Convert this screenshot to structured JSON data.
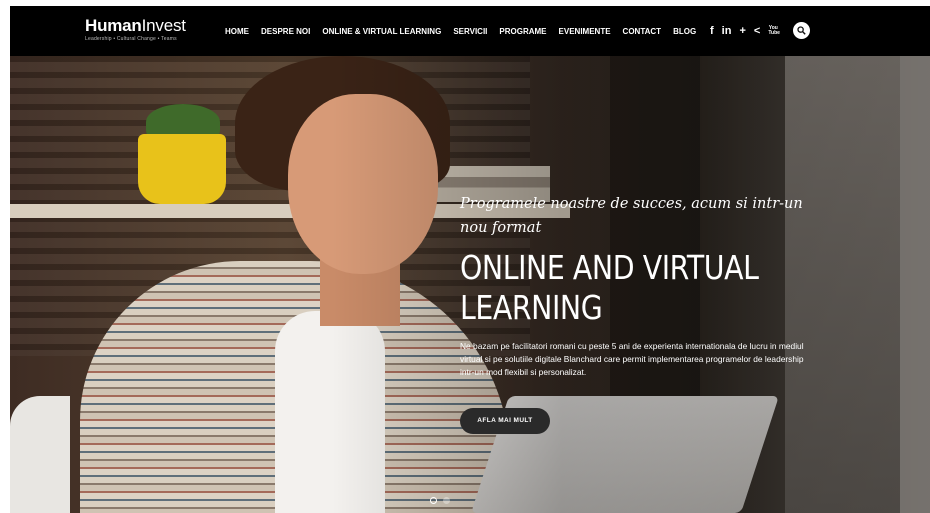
{
  "logo": {
    "bold": "Human",
    "light": "Invest",
    "tagline": "Leadership • Cultural Change • Teams"
  },
  "nav": {
    "items": [
      "HOME",
      "DESPRE NOI",
      "ONLINE & VIRTUAL LEARNING",
      "SERVICII",
      "PROGRAME",
      "EVENIMENTE",
      "CONTACT",
      "BLOG"
    ]
  },
  "social": {
    "facebook": "f",
    "linkedin": "in",
    "plus": "+",
    "share": "<",
    "youtube_top": "You",
    "youtube_bottom": "Tube"
  },
  "hero": {
    "subtitle": "Programele noastre de succes, acum si intr-un nou format",
    "title": "ONLINE AND VIRTUAL LEARNING",
    "body": "Ne bazam pe facilitatori romani cu peste 5 ani de experienta internationala de lucru in mediul virtual si pe solutiile digitale Blanchard care permit implementarea programelor de leadership intr-un mod flexibil si personalizat.",
    "cta_label": "AFLA MAI MULT"
  },
  "slider": {
    "slides": 2,
    "active": 1
  }
}
